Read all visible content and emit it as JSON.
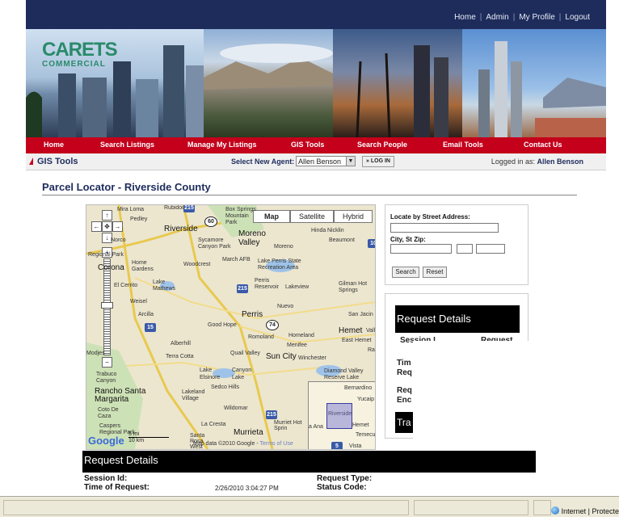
{
  "header": {
    "links": [
      "Home",
      "Admin",
      "My Profile",
      "Logout"
    ]
  },
  "logo": {
    "main": "CARETS",
    "sub": "COMMERCIAL"
  },
  "nav": {
    "items": [
      "Home",
      "Search Listings",
      "Manage My Listings",
      "GIS Tools",
      "Search People",
      "Email Tools",
      "Contact Us"
    ]
  },
  "subbar": {
    "section": "GIS Tools",
    "agent_label": "Select New Agent:",
    "agent_value": "Allen Benson",
    "login_label": "LOG IN",
    "logged_prefix": "Logged in as:",
    "logged_user": "Allen Benson"
  },
  "page": {
    "title": "Parcel Locator - Riverside County"
  },
  "map": {
    "types": [
      "Map",
      "Satellite",
      "Hybrid"
    ],
    "selected_type": "Map",
    "places": {
      "mira_loma": "Mira Loma",
      "rubidoux": "Rubidoux",
      "box_springs": "Box Springs Mountain Park",
      "pedley": "Pedley",
      "riverside": "Riverside",
      "moreno_valley": "Moreno Valley",
      "hinda": "Hinda",
      "nicklin": "Nicklin",
      "beaumont": "Beaumont",
      "norco": "Norco",
      "sycamore": "Sycamore Canyon Park",
      "moreno": "Moreno",
      "regional_park": "Regional Park",
      "corona": "Corona",
      "home_gardens": "Home Gardens",
      "woodcrest": "Woodcrest",
      "march_afb": "March AFB",
      "lake_perris": "Lake Perris State Recreation Area",
      "el_cerrito": "El Cerrito",
      "lake_mathews": "Lake Mathews",
      "perris_reservoir": "Perris Reservoir",
      "lakeview": "Lakeview",
      "gilman": "Gilman Hot Springs",
      "weisel": "Weisel",
      "nuevo": "Nuevo",
      "arcilla": "Arcilla",
      "perris": "Perris",
      "san_jacinto": "San Jacin",
      "good_hope": "Good Hope",
      "romoland": "Romoland",
      "homeland": "Homeland",
      "hemet": "Hemet",
      "valle": "Vall",
      "menifee": "Menifee",
      "east_hemet": "East Hemet",
      "alberhill": "Alberhill",
      "ra": "Ra",
      "modjeska": "Modjes",
      "terra_cotta": "Terra Cotta",
      "quail_valley": "Quail Valley",
      "sun_city": "Sun City",
      "winchester": "Winchester",
      "trabuco": "Trabuco Canyon",
      "lake_elsinore": "Lake Elsinore",
      "canyon_lake": "Canyon Lake",
      "diamond_valley": "Diamond Valley Reserve Lake",
      "sedco": "Sedco Hills",
      "rancho_santa": "Rancho Santa Margarita",
      "lakeland": "Lakeland Village",
      "coto": "Coto De Caza",
      "wildomar": "Wildomar",
      "caspers": "Caspers Regional Park",
      "la_cresta": "La Cresta",
      "santa_rosa": "Santa Rosa West",
      "murrieta": "Murrieta",
      "murrieta_hot": "Murriet Hot Sprin",
      "ov_riverside": "Riverside",
      "ov_bernardino": "Bernardino",
      "ov_yucaipa": "Yucaip",
      "ov_hemet": "Hemet",
      "ov_ana": "a Ana",
      "ov_temecu": "Temecu",
      "ov_vista": "Vista"
    },
    "hwy_labels": {
      "h215a": "215",
      "h60": "60",
      "h215b": "215",
      "h15": "15",
      "h74": "74",
      "h215c": "215",
      "h10": "10",
      "h5": "5"
    },
    "scale_mi": "5 mi",
    "scale_km": "10 km",
    "google": "Google",
    "map_data": "Map data ©2010 Google -",
    "terms": "Terms of Use"
  },
  "locate_form": {
    "street_label": "Locate by Street Address:",
    "city_label": "City, St Zip:",
    "search_btn": "Search",
    "reset_btn": "Reset"
  },
  "request_panel": {
    "title": "Request Details",
    "session_label": "Session I",
    "request_label": "Request",
    "time_label": "Tim Req",
    "req_enc_label": "Req Enc",
    "tra_label": "Tra"
  },
  "request_details": {
    "title": "Request Details",
    "session_id_label": "Session Id:",
    "time_label": "Time of Request:",
    "time_value": "2/26/2010 3:04:27 PM",
    "request_type_label": "Request Type:",
    "status_code_label": "Status Code:"
  },
  "browser_status": {
    "zone": "Internet | Protecte"
  }
}
